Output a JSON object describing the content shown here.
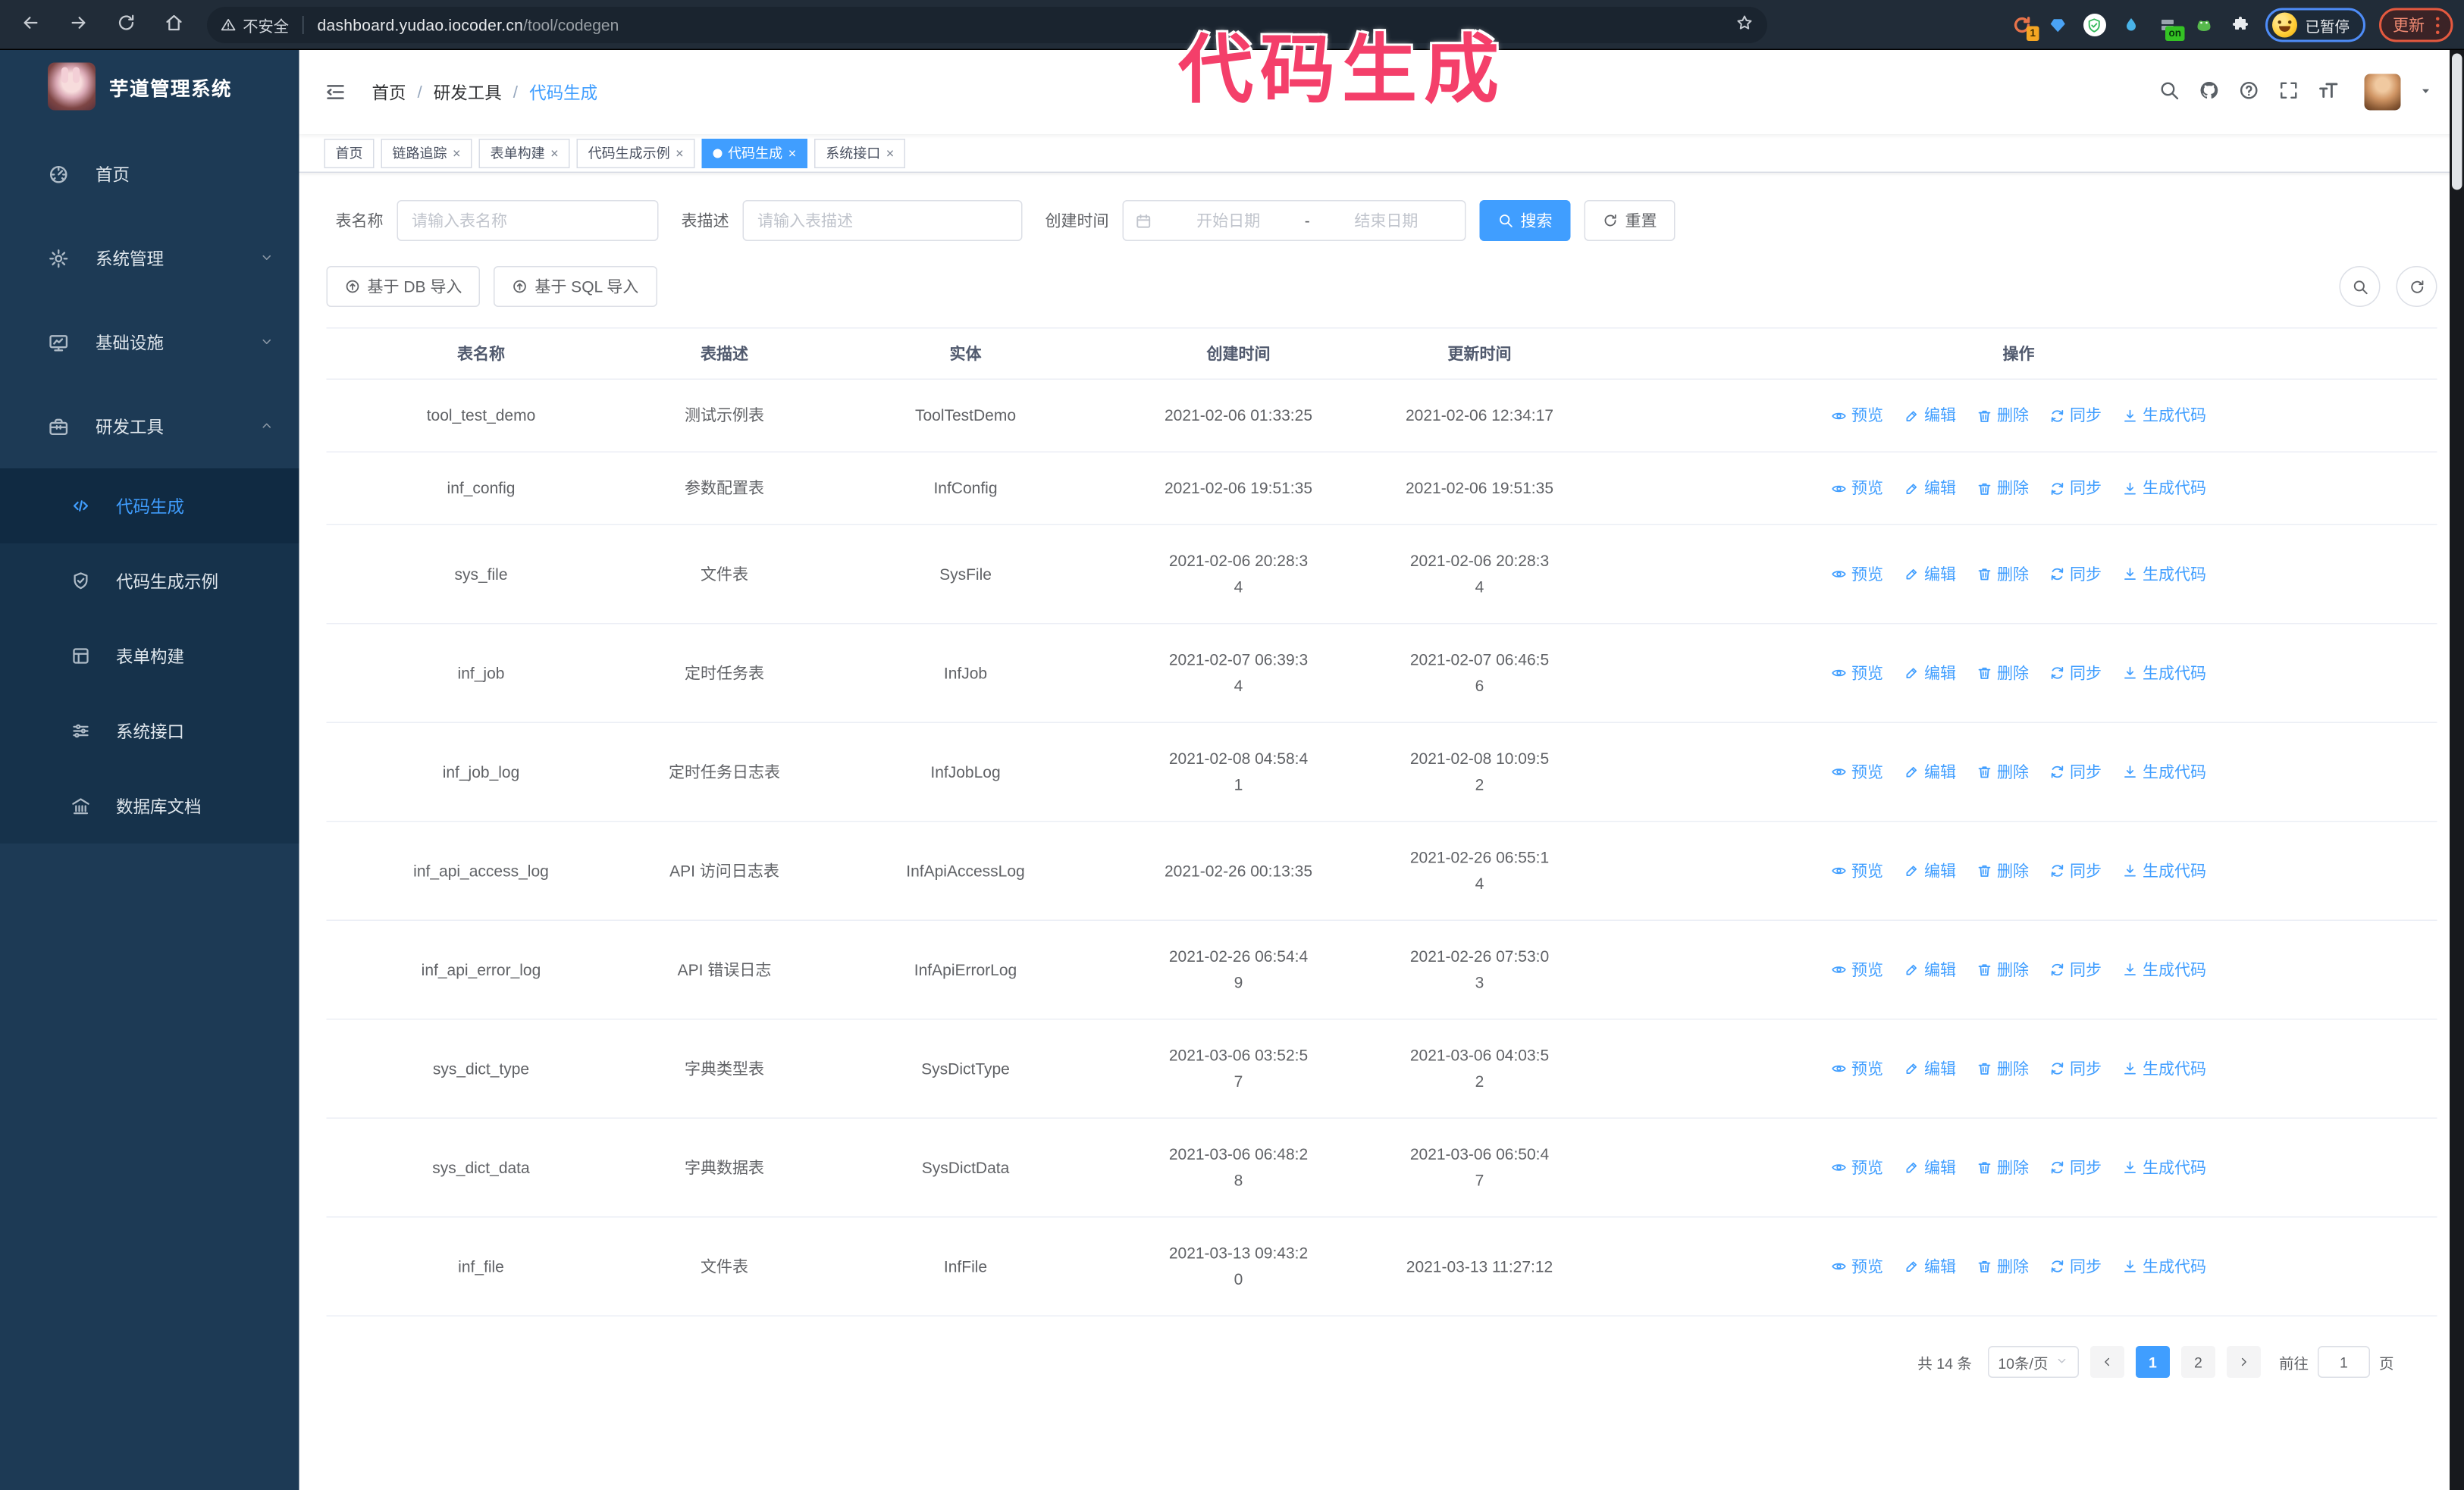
{
  "colors": {
    "primary": "#409EFF",
    "annotation_pink": "#F43F6A",
    "update_accent": "#E4593F",
    "paused_accent": "#4E8CF7",
    "sidebar_bg": "#1D3A55"
  },
  "annotation": {
    "text": "代码生成"
  },
  "browser": {
    "security_warning": "不安全",
    "url_host": "dashboard.yudao.iocoder.cn",
    "url_path": "/tool/codegen",
    "extension_badge_count": "1",
    "extension_on_badge": "on",
    "paused_badge": "已暂停",
    "update_button": "更新"
  },
  "sidebar": {
    "title": "芋道管理系统",
    "items": [
      {
        "label": "首页",
        "icon": "dashboard-icon"
      },
      {
        "label": "系统管理",
        "icon": "gear-icon"
      },
      {
        "label": "基础设施",
        "icon": "monitor-icon"
      },
      {
        "label": "研发工具",
        "icon": "toolbox-icon"
      }
    ],
    "submenu": [
      {
        "label": "代码生成",
        "icon": "code-icon",
        "active": true
      },
      {
        "label": "代码生成示例",
        "icon": "shield-check-icon"
      },
      {
        "label": "表单构建",
        "icon": "form-icon"
      },
      {
        "label": "系统接口",
        "icon": "sliders-icon"
      },
      {
        "label": "数据库文档",
        "icon": "database-doc-icon"
      }
    ]
  },
  "header": {
    "breadcrumb": [
      "首页",
      "研发工具",
      "代码生成"
    ],
    "breadcrumb_separator": "/"
  },
  "tabs": [
    {
      "label": "首页"
    },
    {
      "label": "链路追踪"
    },
    {
      "label": "表单构建"
    },
    {
      "label": "代码生成示例"
    },
    {
      "label": "代码生成",
      "active": true
    },
    {
      "label": "系统接口"
    }
  ],
  "filters": {
    "table_name_label": "表名称",
    "table_name_placeholder": "请输入表名称",
    "table_desc_label": "表描述",
    "table_desc_placeholder": "请输入表描述",
    "create_time_label": "创建时间",
    "date_start_placeholder": "开始日期",
    "date_separator": "-",
    "date_end_placeholder": "结束日期",
    "search_button": "搜索",
    "reset_button": "重置",
    "import_db_button": "基于 DB 导入",
    "import_sql_button": "基于 SQL 导入"
  },
  "table": {
    "columns": [
      "表名称",
      "表描述",
      "实体",
      "创建时间",
      "更新时间",
      "操作"
    ],
    "actions": [
      "预览",
      "编辑",
      "删除",
      "同步",
      "生成代码"
    ],
    "rows": [
      {
        "name": "tool_test_demo",
        "desc": "测试示例表",
        "entity": "ToolTestDemo",
        "create_time": "2021-02-06 01:33:25",
        "update_time": "2021-02-06 12:34:17"
      },
      {
        "name": "inf_config",
        "desc": "参数配置表",
        "entity": "InfConfig",
        "create_time": "2021-02-06 19:51:35",
        "update_time": "2021-02-06 19:51:35"
      },
      {
        "name": "sys_file",
        "desc": "文件表",
        "entity": "SysFile",
        "create_time": "2021-02-06 20:28:3\n4",
        "update_time": "2021-02-06 20:28:3\n4"
      },
      {
        "name": "inf_job",
        "desc": "定时任务表",
        "entity": "InfJob",
        "create_time": "2021-02-07 06:39:3\n4",
        "update_time": "2021-02-07 06:46:5\n6"
      },
      {
        "name": "inf_job_log",
        "desc": "定时任务日志表",
        "entity": "InfJobLog",
        "create_time": "2021-02-08 04:58:4\n1",
        "update_time": "2021-02-08 10:09:5\n2"
      },
      {
        "name": "inf_api_access_log",
        "desc": "API 访问日志表",
        "entity": "InfApiAccessLog",
        "create_time": "2021-02-26 00:13:35",
        "update_time": "2021-02-26 06:55:1\n4"
      },
      {
        "name": "inf_api_error_log",
        "desc": "API 错误日志",
        "entity": "InfApiErrorLog",
        "create_time": "2021-02-26 06:54:4\n9",
        "update_time": "2021-02-26 07:53:0\n3"
      },
      {
        "name": "sys_dict_type",
        "desc": "字典类型表",
        "entity": "SysDictType",
        "create_time": "2021-03-06 03:52:5\n7",
        "update_time": "2021-03-06 04:03:5\n2"
      },
      {
        "name": "sys_dict_data",
        "desc": "字典数据表",
        "entity": "SysDictData",
        "create_time": "2021-03-06 06:48:2\n8",
        "update_time": "2021-03-06 06:50:4\n7"
      },
      {
        "name": "inf_file",
        "desc": "文件表",
        "entity": "InfFile",
        "create_time": "2021-03-13 09:43:2\n0",
        "update_time": "2021-03-13 11:27:12"
      }
    ]
  },
  "pagination": {
    "total_text": "共 14 条",
    "page_size": "10条/页",
    "pages": [
      "1",
      "2"
    ],
    "active_page": "1",
    "goto_label": "前往",
    "goto_value": "1",
    "goto_suffix": "页"
  }
}
